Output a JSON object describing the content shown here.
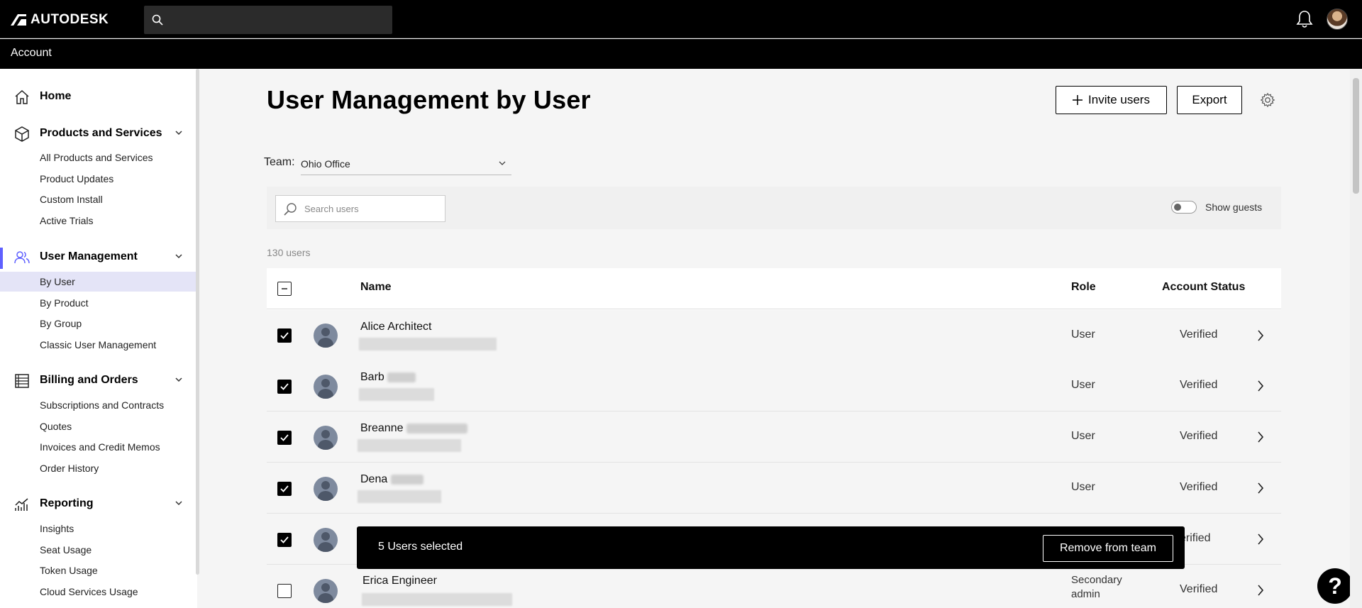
{
  "brand": "AUTODESK",
  "topbar": {
    "search_placeholder": ""
  },
  "subbar": {
    "title": "Account"
  },
  "sidebar": {
    "home": "Home",
    "products": {
      "label": "Products and Services",
      "items": [
        "All Products and Services",
        "Product Updates",
        "Custom Install",
        "Active Trials"
      ]
    },
    "user_management": {
      "label": "User Management",
      "items": [
        "By User",
        "By Product",
        "By Group",
        "Classic User Management"
      ],
      "active_item": "By User"
    },
    "billing": {
      "label": "Billing and Orders",
      "items": [
        "Subscriptions and Contracts",
        "Quotes",
        "Invoices and Credit Memos",
        "Order History"
      ]
    },
    "reporting": {
      "label": "Reporting",
      "items": [
        "Insights",
        "Seat Usage",
        "Token Usage",
        "Cloud Services Usage"
      ]
    }
  },
  "page": {
    "title": "User Management by User",
    "invite_label": "Invite users",
    "export_label": "Export",
    "team_label": "Team:",
    "team_value": "Ohio Office",
    "search_placeholder": "Search users",
    "show_guests_label": "Show guests",
    "show_guests_on": false,
    "user_count": "130 users"
  },
  "table": {
    "columns": {
      "name": "Name",
      "role": "Role",
      "status": "Account Status"
    },
    "rows": [
      {
        "first": "Alice Architect",
        "checked": true,
        "role": "User",
        "role2": "",
        "status": "Verified"
      },
      {
        "first": "Barb",
        "checked": true,
        "role": "User",
        "role2": "",
        "status": "Verified"
      },
      {
        "first": "Breanne",
        "checked": true,
        "role": "User",
        "role2": "",
        "status": "Verified"
      },
      {
        "first": "Dena",
        "checked": true,
        "role": "User",
        "role2": "",
        "status": "Verified"
      },
      {
        "first": "",
        "checked": true,
        "role": "",
        "role2": "",
        "status": "erified"
      },
      {
        "first": "Erica Engineer",
        "checked": false,
        "role": "Secondary",
        "role2": "admin",
        "status": "Verified"
      }
    ]
  },
  "snackbar": {
    "text": "5 Users selected",
    "action": "Remove from team"
  },
  "help_label": "?",
  "colors": {
    "accent": "#5f60ff",
    "active_bg": "#e4e4f7",
    "topbar": "#000000"
  }
}
